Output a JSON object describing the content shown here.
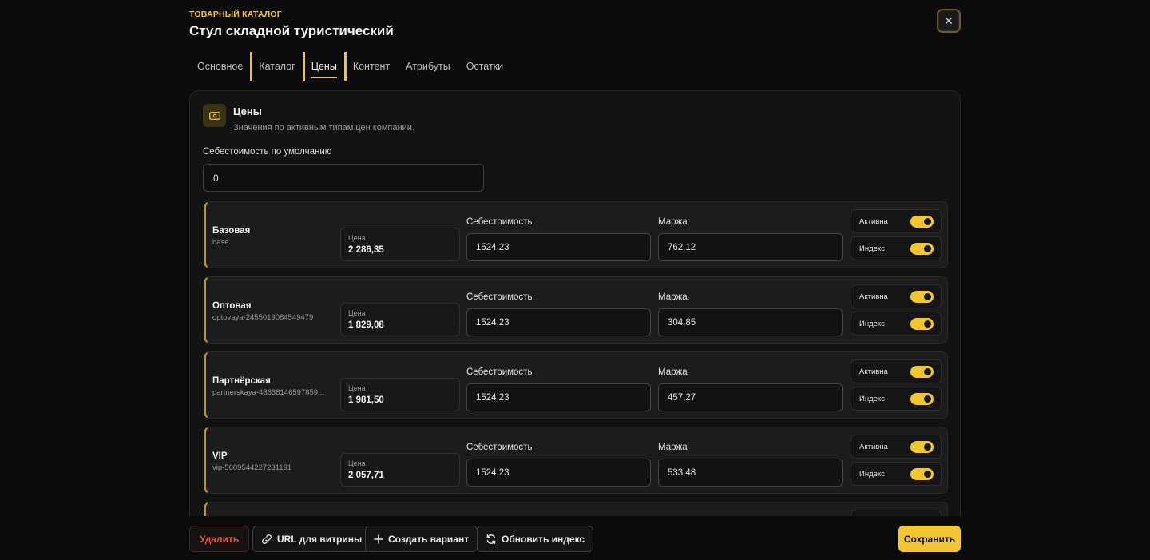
{
  "header": {
    "eyebrow": "ТОВАРНЫЙ КАТАЛОГ",
    "title": "Стул складной туристический",
    "close_icon": "close-icon"
  },
  "tabs": [
    {
      "label": "Основное",
      "active": false
    },
    {
      "label": "Каталог",
      "active": false
    },
    {
      "label": "Цены",
      "active": true
    },
    {
      "label": "Контент",
      "active": false
    },
    {
      "label": "Атрибуты",
      "active": false
    },
    {
      "label": "Остатки",
      "active": false
    }
  ],
  "section": {
    "icon": "banknote-icon",
    "title": "Цены",
    "subtitle": "Значения по активным типам цен компании.",
    "default_cost_label": "Себестоимость по умолчанию",
    "default_cost_value": "0"
  },
  "labels": {
    "price": "Цена",
    "cost": "Себестоимость",
    "margin": "Маржа",
    "active": "Активна",
    "index": "Индекс"
  },
  "price_rows": [
    {
      "name": "Базовая",
      "code": "base",
      "price": "2 286,35",
      "cost": "1524,23",
      "margin": "762,12",
      "active": true,
      "index": true
    },
    {
      "name": "Оптовая",
      "code": "optovaya-2455019084549479",
      "price": "1 829,08",
      "cost": "1524,23",
      "margin": "304,85",
      "active": true,
      "index": true
    },
    {
      "name": "Партнёрская",
      "code": "partnerskaya-43638146597859...",
      "price": "1 981,50",
      "cost": "1524,23",
      "margin": "457,27",
      "active": true,
      "index": true
    },
    {
      "name": "VIP",
      "code": "vip-5609544227231191",
      "price": "2 057,71",
      "cost": "1524,23",
      "margin": "533,48",
      "active": true,
      "index": true
    }
  ],
  "footer": {
    "delete": "Удалить",
    "storefront_url": "URL для витрины",
    "create_variant": "Создать вариант",
    "refresh_index": "Обновить индекс",
    "save": "Сохранить"
  },
  "colors": {
    "accent": "#f2c631",
    "danger": "#e8534f",
    "background": "#0b0b0c"
  }
}
